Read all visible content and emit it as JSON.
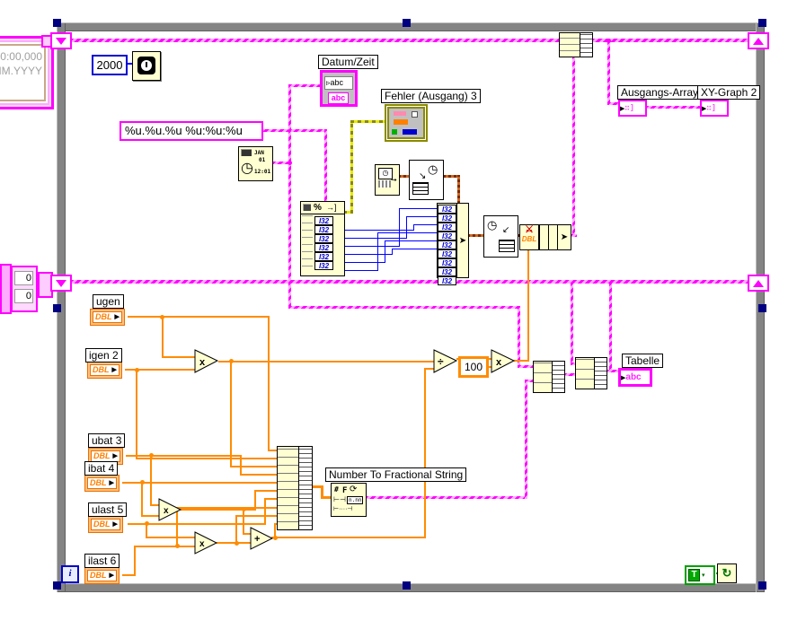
{
  "loop": {
    "wait_ms": "2000",
    "iteration": "i",
    "continue_value": "T"
  },
  "constants": {
    "timestamp_line1": "0:00,000",
    "timestamp_line2": "MM.YYYY",
    "init_zero_1": "0",
    "init_zero_2": "0",
    "format_string": "%u.%u.%u %u:%u:%u",
    "hundred": "100"
  },
  "labels": {
    "datum_zeit": "Datum/Zeit",
    "fehler_ausgang": "Fehler (Ausgang) 3",
    "number_to_fractional": "Number To Fractional String",
    "ausgangs_array": "Ausgangs-Array",
    "xy_graph": "XY-Graph 2",
    "tabelle": "Tabelle"
  },
  "terminals": [
    {
      "label": "ugen",
      "type": "DBL"
    },
    {
      "label": "igen 2",
      "type": "DBL"
    },
    {
      "label": "ubat 3",
      "type": "DBL"
    },
    {
      "label": "ibat 4",
      "type": "DBL"
    },
    {
      "label": "ulast 5",
      "type": "DBL"
    },
    {
      "label": "ilast 6",
      "type": "DBL"
    }
  ],
  "glyphs": {
    "dbl": "DBL",
    "i32": "I32",
    "abc": "abc",
    "multiply": "x",
    "divide": "÷",
    "add": "+",
    "jan": "JAN",
    "day": "01",
    "time": "12:01",
    "percent": "%",
    "nnn": "n.nn",
    "hash": "#",
    "f": "F",
    "array_glyph": "∷]"
  },
  "colors": {
    "wire_string": "#ff00ff",
    "wire_dbl": "#ff8c00",
    "wire_i32": "#0000ff",
    "wire_error": "#8a8a00",
    "wire_cluster": "#7a2b00",
    "loop_border": "#848484",
    "selection_handle": "#000080"
  }
}
